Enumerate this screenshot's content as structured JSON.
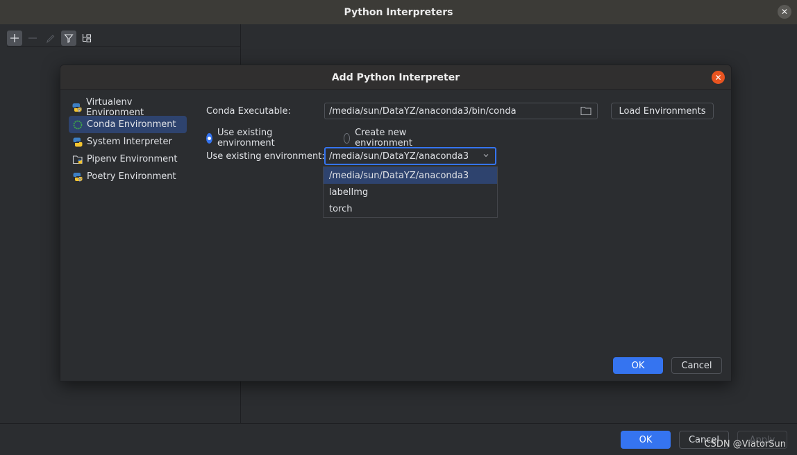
{
  "outer_window": {
    "title": "Python Interpreters",
    "close_label": "✕",
    "toolbar": {
      "add_icon": "plus-icon",
      "remove_icon": "minus-icon",
      "edit_icon": "pencil-icon",
      "filter_icon": "filter-icon",
      "tree_icon": "tree-view-icon"
    },
    "footer": {
      "ok_label": "OK",
      "cancel_label": "Cancel",
      "apply_label": "Apply"
    }
  },
  "dialog": {
    "title": "Add Python Interpreter",
    "close_label": "✕",
    "environments": [
      {
        "label": "Virtualenv Environment",
        "icon": "python-virtualenv-icon",
        "selected": false
      },
      {
        "label": "Conda Environment",
        "icon": "conda-icon",
        "selected": true
      },
      {
        "label": "System Interpreter",
        "icon": "python-icon",
        "selected": false
      },
      {
        "label": "Pipenv Environment",
        "icon": "pipenv-folder-icon",
        "selected": false
      },
      {
        "label": "Poetry Environment",
        "icon": "poetry-icon",
        "selected": false
      }
    ],
    "form": {
      "conda_executable_label": "Conda Executable:",
      "conda_executable_value": "/media/sun/DataYZ/anaconda3/bin/conda",
      "load_environments_label": "Load Environments",
      "radio_use_existing": "Use existing environment",
      "radio_create_new": "Create new environment",
      "radio_selected": "use_existing",
      "existing_env_label": "Use existing environment:",
      "existing_env_value": "/media/sun/DataYZ/anaconda3",
      "dropdown_options": [
        {
          "label": "/media/sun/DataYZ/anaconda3",
          "selected": true
        },
        {
          "label": "labelImg",
          "selected": false
        },
        {
          "label": "torch",
          "selected": false
        }
      ]
    },
    "ok_label": "OK",
    "cancel_label": "Cancel"
  },
  "colors": {
    "accent": "#3574f0",
    "selection": "#2e436e",
    "close_orange": "#e95420",
    "background": "#2b2d30"
  },
  "watermark": "CSDN @ViatorSun"
}
